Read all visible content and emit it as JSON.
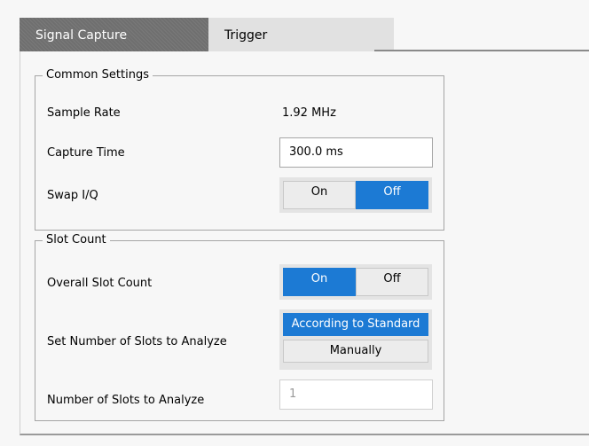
{
  "tabs": [
    {
      "label": "Signal Capture",
      "active": true
    },
    {
      "label": "Trigger",
      "active": false
    }
  ],
  "common_settings": {
    "title": "Common Settings",
    "sample_rate": {
      "label": "Sample Rate",
      "value": "1.92 MHz"
    },
    "capture_time": {
      "label": "Capture Time",
      "value": "300.0 ms"
    },
    "swap_iq": {
      "label": "Swap I/Q",
      "options": [
        "On",
        "Off"
      ],
      "selected": "Off"
    }
  },
  "slot_count": {
    "title": "Slot Count",
    "overall": {
      "label": "Overall Slot Count",
      "options": [
        "On",
        "Off"
      ],
      "selected": "On"
    },
    "set_number": {
      "label": "Set Number of Slots to Analyze",
      "options": [
        "According to Standard",
        "Manually"
      ],
      "selected": "According to Standard"
    },
    "number": {
      "label": "Number of Slots to Analyze",
      "value": "1"
    }
  },
  "colors": {
    "accent": "#1c7ad4",
    "tab_active": "#6f6f6f",
    "tab_inactive": "#e1e1e1"
  }
}
